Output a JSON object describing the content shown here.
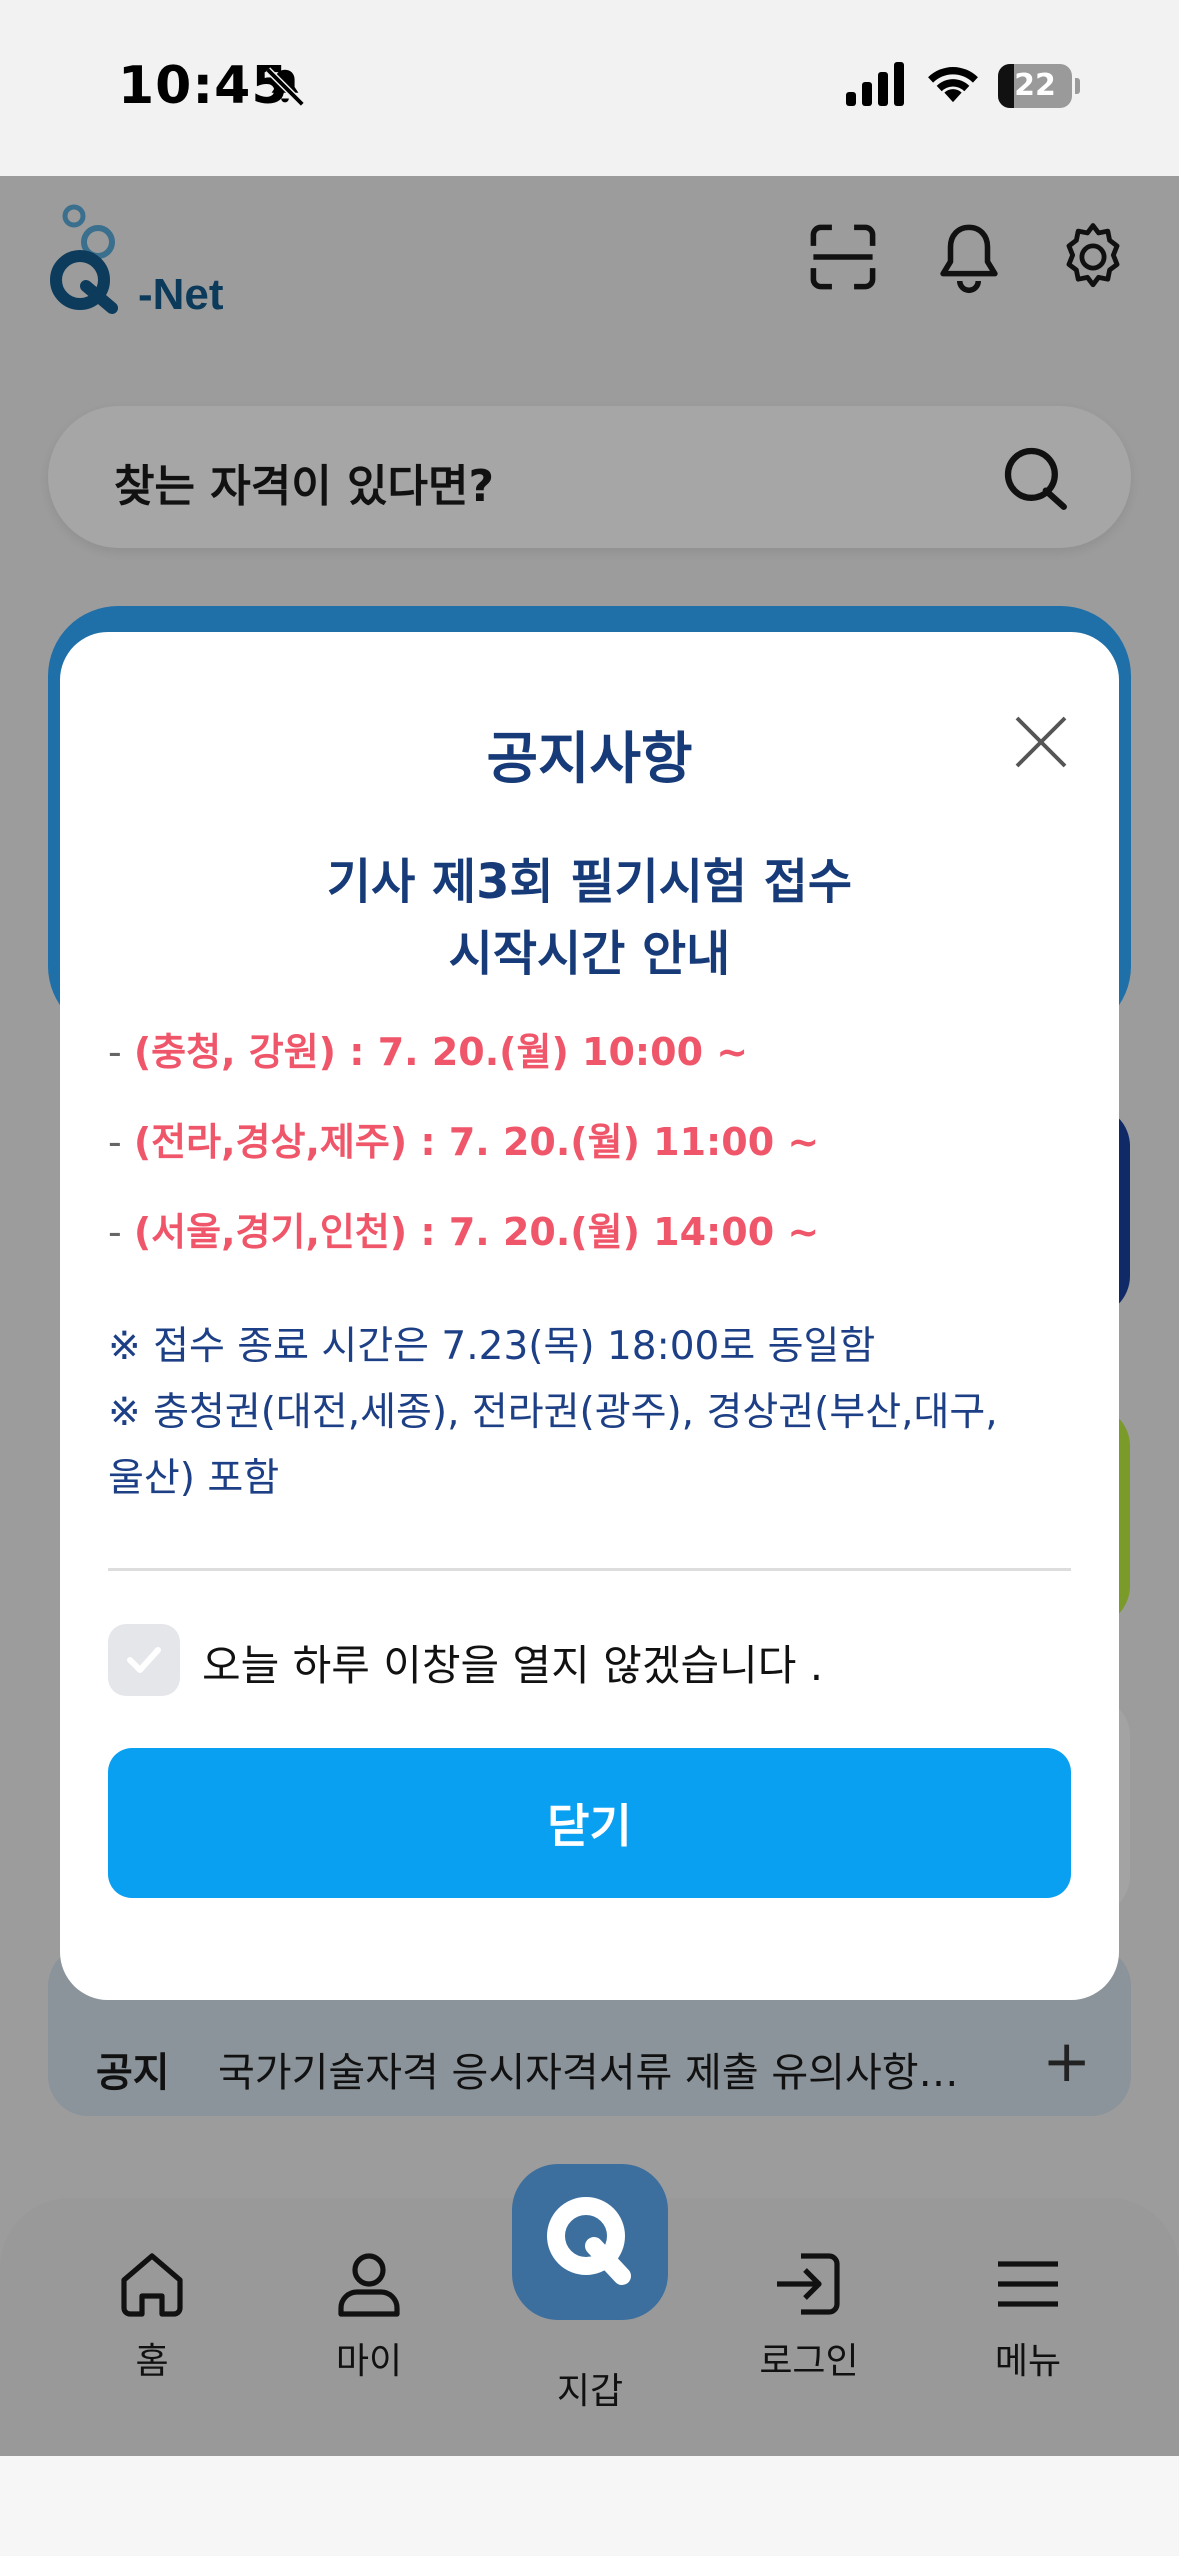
{
  "status_bar": {
    "time": "10:45",
    "battery": "22",
    "battery_level": 0.22
  },
  "header": {
    "logo_text": "-Net",
    "search_placeholder": "찾는 자격이 있다면?"
  },
  "notice_bar": {
    "label": "공지",
    "text": "국가기술자격 응시자격서류 제출 유의사항…",
    "expand": "+"
  },
  "nav": {
    "items": [
      {
        "label": "홈",
        "icon": "home-icon"
      },
      {
        "label": "마이",
        "icon": "person-icon"
      },
      {
        "label": "지갑",
        "icon": "wallet-q-icon"
      },
      {
        "label": "로그인",
        "icon": "login-icon"
      },
      {
        "label": "메뉴",
        "icon": "menu-icon"
      }
    ]
  },
  "modal": {
    "title": "공지사항",
    "subtitle_line1": "기사 제3회 필기시험 접수",
    "subtitle_line2": "시작시간 안내",
    "schedule": [
      {
        "dash": "-",
        "text": "(충청, 강원) : 7. 20.(월) 10:00 ~"
      },
      {
        "dash": "-",
        "text": "(전라,경상,제주) : 7. 20.(월) 11:00 ~"
      },
      {
        "dash": "-",
        "text": "(서울,경기,인천) : 7. 20.(월) 14:00 ~"
      }
    ],
    "note1": "※ 접수 종료 시간은 7.23(목) 18:00로 동일함",
    "note2_line1": "※ 충청권(대전,세종), 전라권(광주), 경상권(부산,대구,",
    "note2_line2": "울산) 포함",
    "checkbox_label": "오늘 하루 이창을 열지 않겠습니다 .",
    "close_button": "닫기"
  },
  "colors": {
    "accent": "#0aa0f2",
    "title_navy": "#163b78",
    "schedule_red": "#f0566a",
    "note_blue": "#1d3f86"
  }
}
